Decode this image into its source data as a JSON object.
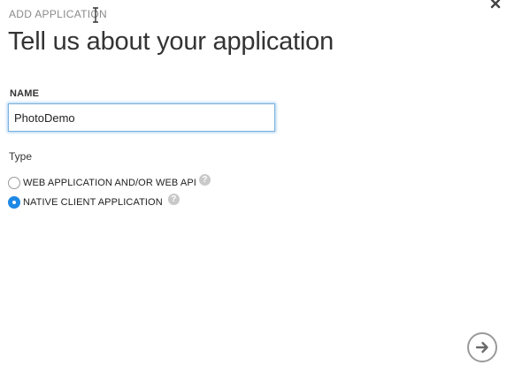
{
  "wizard": {
    "header": "ADD APPLICATION",
    "title": "Tell us about your application"
  },
  "form": {
    "name_label": "NAME",
    "name_value": "PhotoDemo",
    "type_label": "Type",
    "type_options": [
      {
        "label": "WEB APPLICATION AND/OR WEB API",
        "selected": false
      },
      {
        "label": "NATIVE CLIENT APPLICATION",
        "selected": true
      }
    ]
  },
  "icons": {
    "close": "close-icon",
    "help": "help-icon",
    "next": "arrow-right-icon",
    "cursor": "text-cursor-icon"
  },
  "colors": {
    "accent": "#1e88e5",
    "input_focus_border": "#7ab0de",
    "muted_text": "#8a8a8a",
    "help_icon_bg": "#c9c9c9"
  }
}
